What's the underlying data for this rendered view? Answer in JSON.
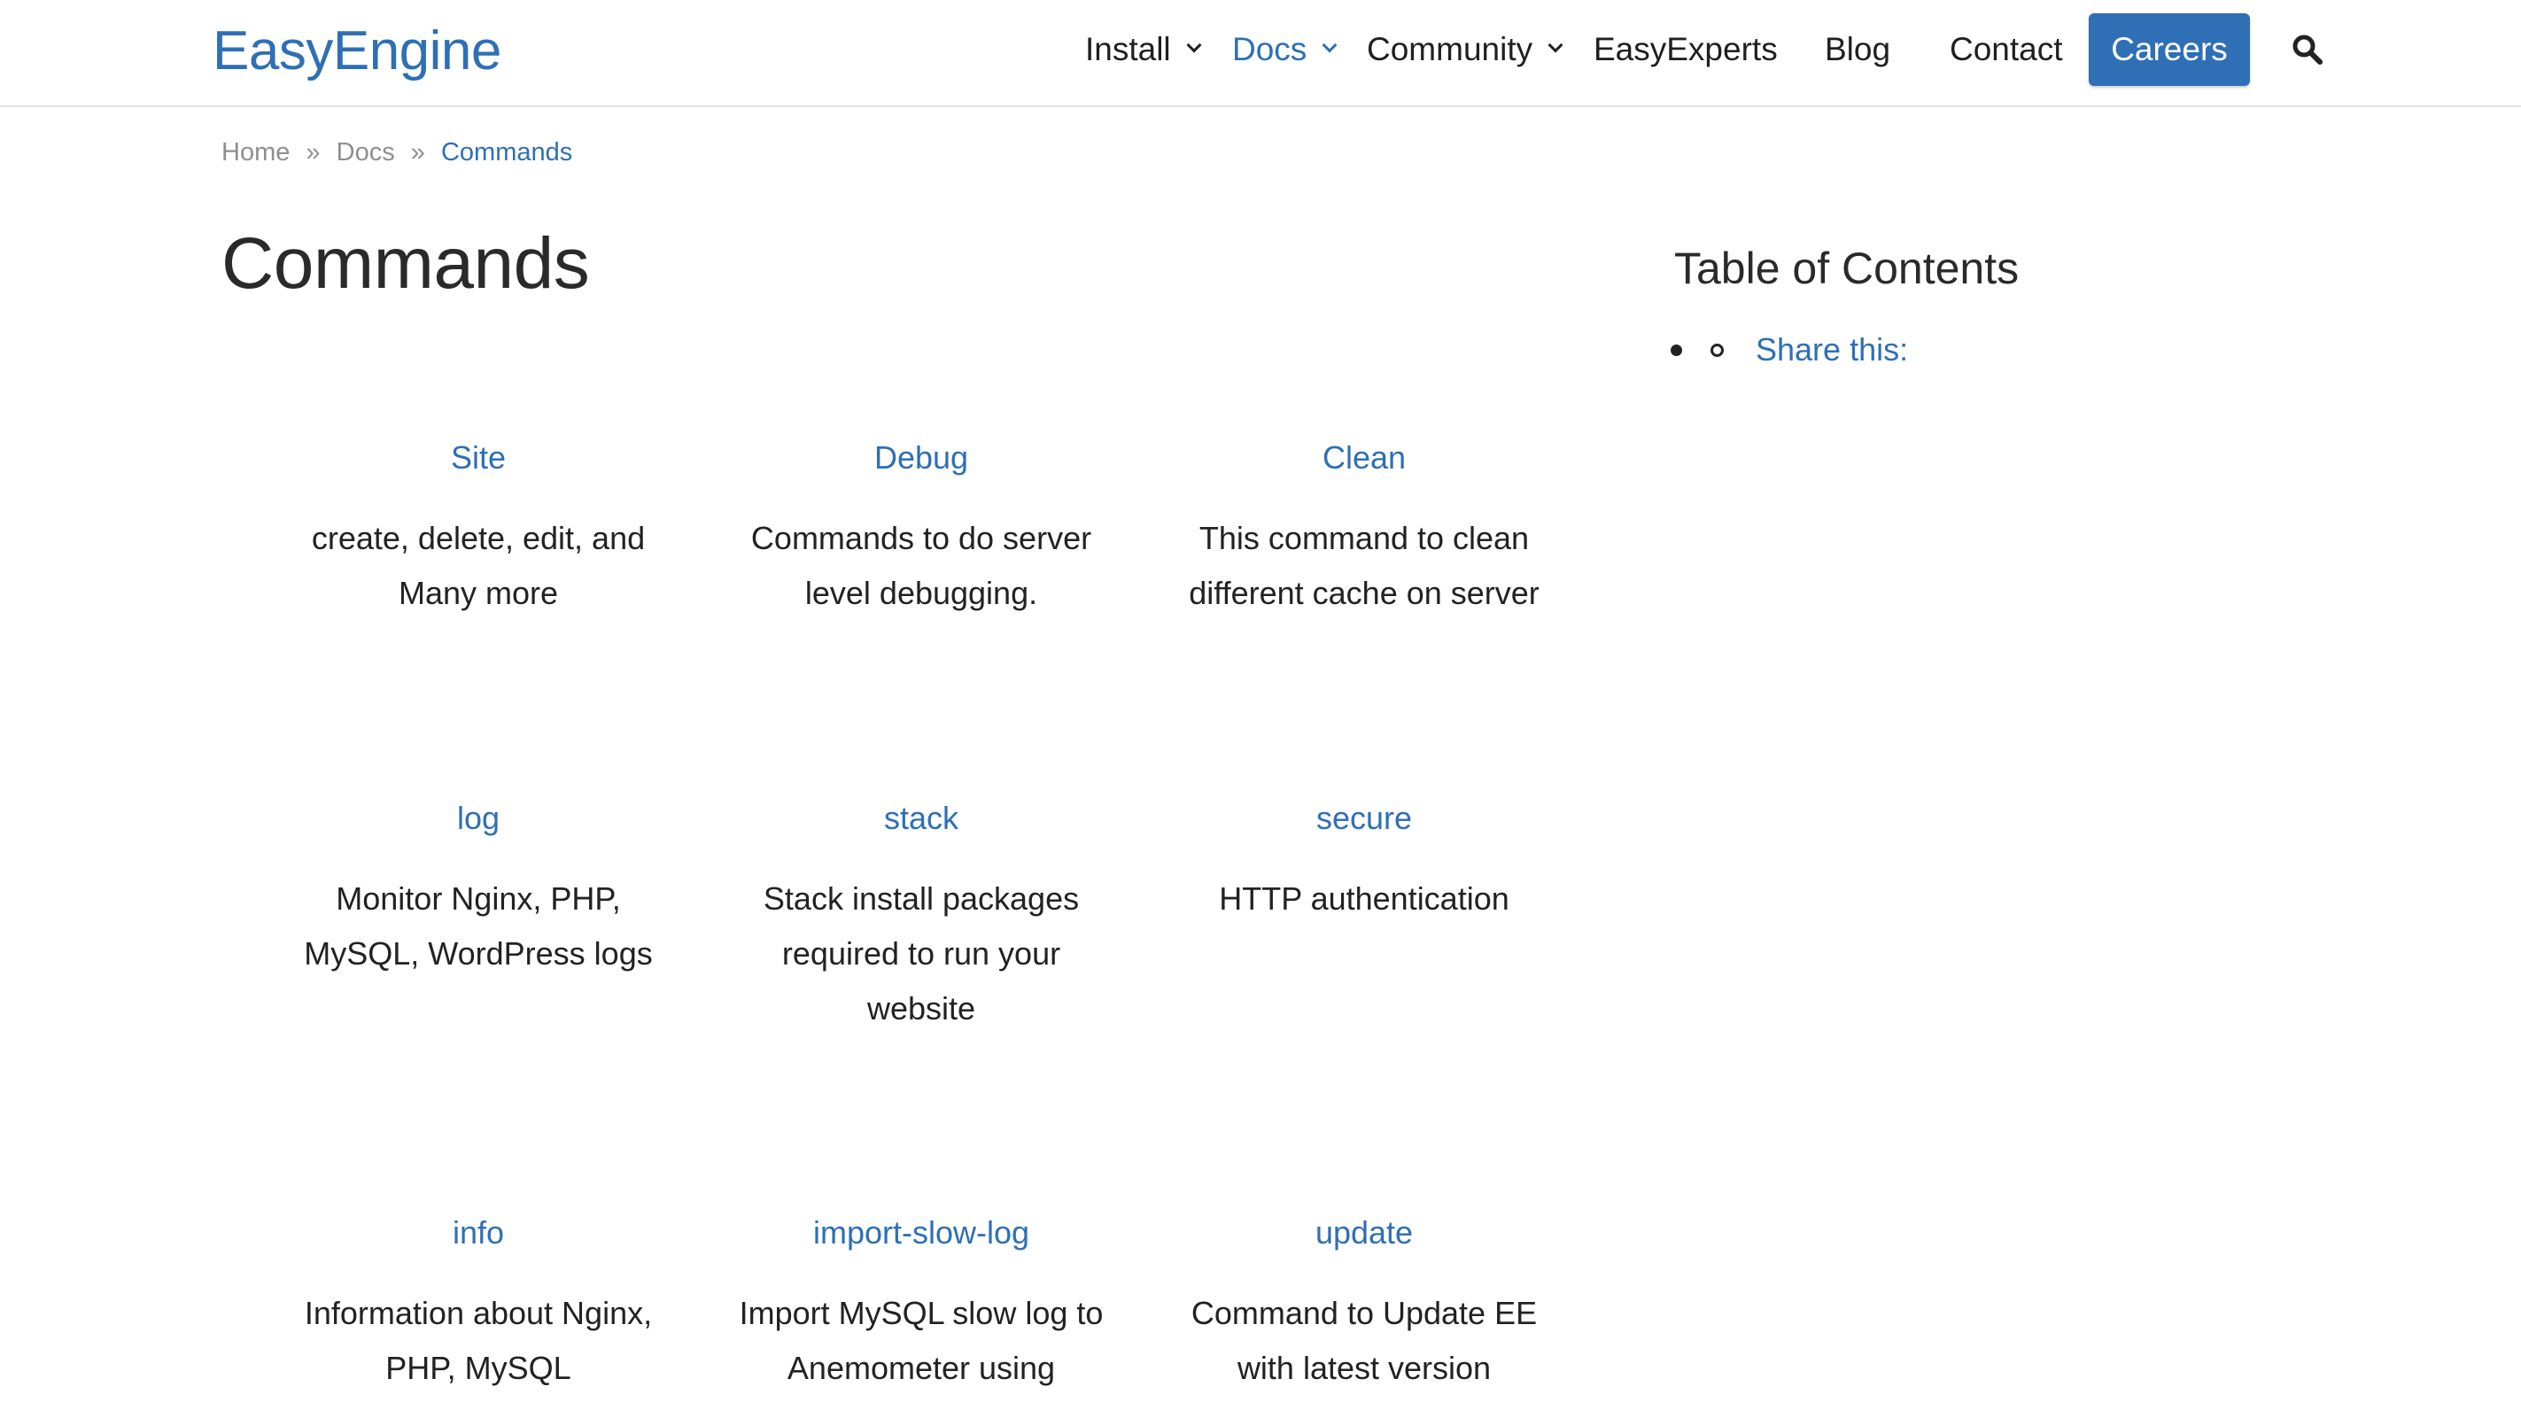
{
  "header": {
    "logo": "EasyEngine",
    "nav": {
      "install": "Install",
      "docs": "Docs",
      "community": "Community",
      "easyexperts": "EasyExperts",
      "blog": "Blog",
      "contact": "Contact",
      "careers": "Careers"
    },
    "search_icon": "search-icon",
    "accent_color": "#2e6fb6"
  },
  "breadcrumb": {
    "items": [
      "Home",
      "Docs",
      "Commands"
    ],
    "separator": "»"
  },
  "page": {
    "title": "Commands"
  },
  "commands": [
    {
      "title": "Site",
      "lines": [
        "create, delete, edit, and",
        "Many more"
      ]
    },
    {
      "title": "Debug",
      "lines": [
        "Commands to do server",
        "level debugging."
      ]
    },
    {
      "title": "Clean",
      "lines": [
        "This command to clean",
        "different cache on server"
      ]
    },
    {
      "title": "log",
      "lines": [
        "Monitor Nginx, PHP,",
        "MySQL, WordPress logs"
      ]
    },
    {
      "title": "stack",
      "lines": [
        "Stack install packages",
        "required to run your",
        "website"
      ]
    },
    {
      "title": "secure",
      "lines": [
        "HTTP authentication"
      ]
    },
    {
      "title": "info",
      "lines": [
        "Information about Nginx,",
        "PHP, MySQL"
      ]
    },
    {
      "title": "import-slow-log",
      "lines": [
        "Import MySQL slow log to",
        "Anemometer using"
      ]
    },
    {
      "title": "update",
      "lines": [
        "Command to Update EE",
        "with latest version"
      ]
    }
  ],
  "toc": {
    "title": "Table of Contents",
    "items": [
      "Share this:"
    ]
  }
}
